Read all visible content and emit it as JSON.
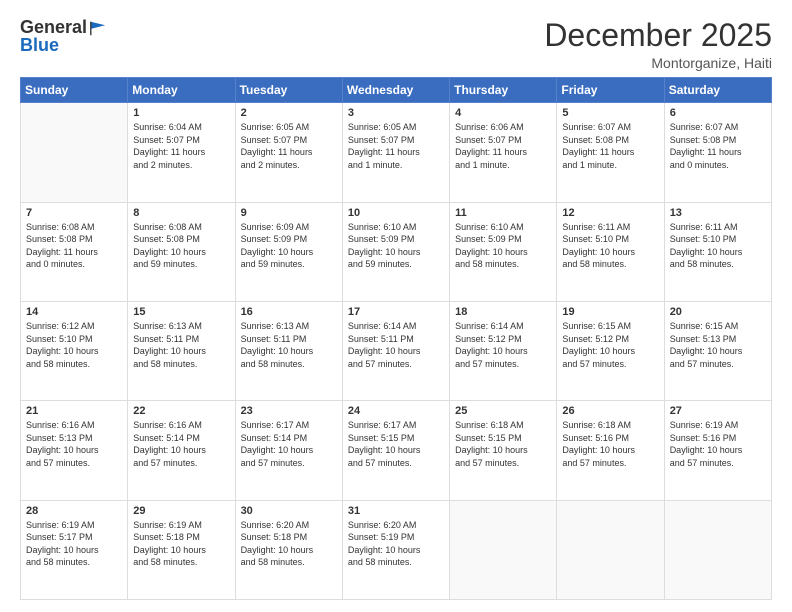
{
  "header": {
    "logo_general": "General",
    "logo_blue": "Blue",
    "main_title": "December 2025",
    "subtitle": "Montorganize, Haiti"
  },
  "days_of_week": [
    "Sunday",
    "Monday",
    "Tuesday",
    "Wednesday",
    "Thursday",
    "Friday",
    "Saturday"
  ],
  "weeks": [
    [
      {
        "day": "",
        "info": ""
      },
      {
        "day": "1",
        "info": "Sunrise: 6:04 AM\nSunset: 5:07 PM\nDaylight: 11 hours\nand 2 minutes."
      },
      {
        "day": "2",
        "info": "Sunrise: 6:05 AM\nSunset: 5:07 PM\nDaylight: 11 hours\nand 2 minutes."
      },
      {
        "day": "3",
        "info": "Sunrise: 6:05 AM\nSunset: 5:07 PM\nDaylight: 11 hours\nand 1 minute."
      },
      {
        "day": "4",
        "info": "Sunrise: 6:06 AM\nSunset: 5:07 PM\nDaylight: 11 hours\nand 1 minute."
      },
      {
        "day": "5",
        "info": "Sunrise: 6:07 AM\nSunset: 5:08 PM\nDaylight: 11 hours\nand 1 minute."
      },
      {
        "day": "6",
        "info": "Sunrise: 6:07 AM\nSunset: 5:08 PM\nDaylight: 11 hours\nand 0 minutes."
      }
    ],
    [
      {
        "day": "7",
        "info": "Sunrise: 6:08 AM\nSunset: 5:08 PM\nDaylight: 11 hours\nand 0 minutes."
      },
      {
        "day": "8",
        "info": "Sunrise: 6:08 AM\nSunset: 5:08 PM\nDaylight: 10 hours\nand 59 minutes."
      },
      {
        "day": "9",
        "info": "Sunrise: 6:09 AM\nSunset: 5:09 PM\nDaylight: 10 hours\nand 59 minutes."
      },
      {
        "day": "10",
        "info": "Sunrise: 6:10 AM\nSunset: 5:09 PM\nDaylight: 10 hours\nand 59 minutes."
      },
      {
        "day": "11",
        "info": "Sunrise: 6:10 AM\nSunset: 5:09 PM\nDaylight: 10 hours\nand 58 minutes."
      },
      {
        "day": "12",
        "info": "Sunrise: 6:11 AM\nSunset: 5:10 PM\nDaylight: 10 hours\nand 58 minutes."
      },
      {
        "day": "13",
        "info": "Sunrise: 6:11 AM\nSunset: 5:10 PM\nDaylight: 10 hours\nand 58 minutes."
      }
    ],
    [
      {
        "day": "14",
        "info": "Sunrise: 6:12 AM\nSunset: 5:10 PM\nDaylight: 10 hours\nand 58 minutes."
      },
      {
        "day": "15",
        "info": "Sunrise: 6:13 AM\nSunset: 5:11 PM\nDaylight: 10 hours\nand 58 minutes."
      },
      {
        "day": "16",
        "info": "Sunrise: 6:13 AM\nSunset: 5:11 PM\nDaylight: 10 hours\nand 58 minutes."
      },
      {
        "day": "17",
        "info": "Sunrise: 6:14 AM\nSunset: 5:11 PM\nDaylight: 10 hours\nand 57 minutes."
      },
      {
        "day": "18",
        "info": "Sunrise: 6:14 AM\nSunset: 5:12 PM\nDaylight: 10 hours\nand 57 minutes."
      },
      {
        "day": "19",
        "info": "Sunrise: 6:15 AM\nSunset: 5:12 PM\nDaylight: 10 hours\nand 57 minutes."
      },
      {
        "day": "20",
        "info": "Sunrise: 6:15 AM\nSunset: 5:13 PM\nDaylight: 10 hours\nand 57 minutes."
      }
    ],
    [
      {
        "day": "21",
        "info": "Sunrise: 6:16 AM\nSunset: 5:13 PM\nDaylight: 10 hours\nand 57 minutes."
      },
      {
        "day": "22",
        "info": "Sunrise: 6:16 AM\nSunset: 5:14 PM\nDaylight: 10 hours\nand 57 minutes."
      },
      {
        "day": "23",
        "info": "Sunrise: 6:17 AM\nSunset: 5:14 PM\nDaylight: 10 hours\nand 57 minutes."
      },
      {
        "day": "24",
        "info": "Sunrise: 6:17 AM\nSunset: 5:15 PM\nDaylight: 10 hours\nand 57 minutes."
      },
      {
        "day": "25",
        "info": "Sunrise: 6:18 AM\nSunset: 5:15 PM\nDaylight: 10 hours\nand 57 minutes."
      },
      {
        "day": "26",
        "info": "Sunrise: 6:18 AM\nSunset: 5:16 PM\nDaylight: 10 hours\nand 57 minutes."
      },
      {
        "day": "27",
        "info": "Sunrise: 6:19 AM\nSunset: 5:16 PM\nDaylight: 10 hours\nand 57 minutes."
      }
    ],
    [
      {
        "day": "28",
        "info": "Sunrise: 6:19 AM\nSunset: 5:17 PM\nDaylight: 10 hours\nand 58 minutes."
      },
      {
        "day": "29",
        "info": "Sunrise: 6:19 AM\nSunset: 5:18 PM\nDaylight: 10 hours\nand 58 minutes."
      },
      {
        "day": "30",
        "info": "Sunrise: 6:20 AM\nSunset: 5:18 PM\nDaylight: 10 hours\nand 58 minutes."
      },
      {
        "day": "31",
        "info": "Sunrise: 6:20 AM\nSunset: 5:19 PM\nDaylight: 10 hours\nand 58 minutes."
      },
      {
        "day": "",
        "info": ""
      },
      {
        "day": "",
        "info": ""
      },
      {
        "day": "",
        "info": ""
      }
    ]
  ]
}
